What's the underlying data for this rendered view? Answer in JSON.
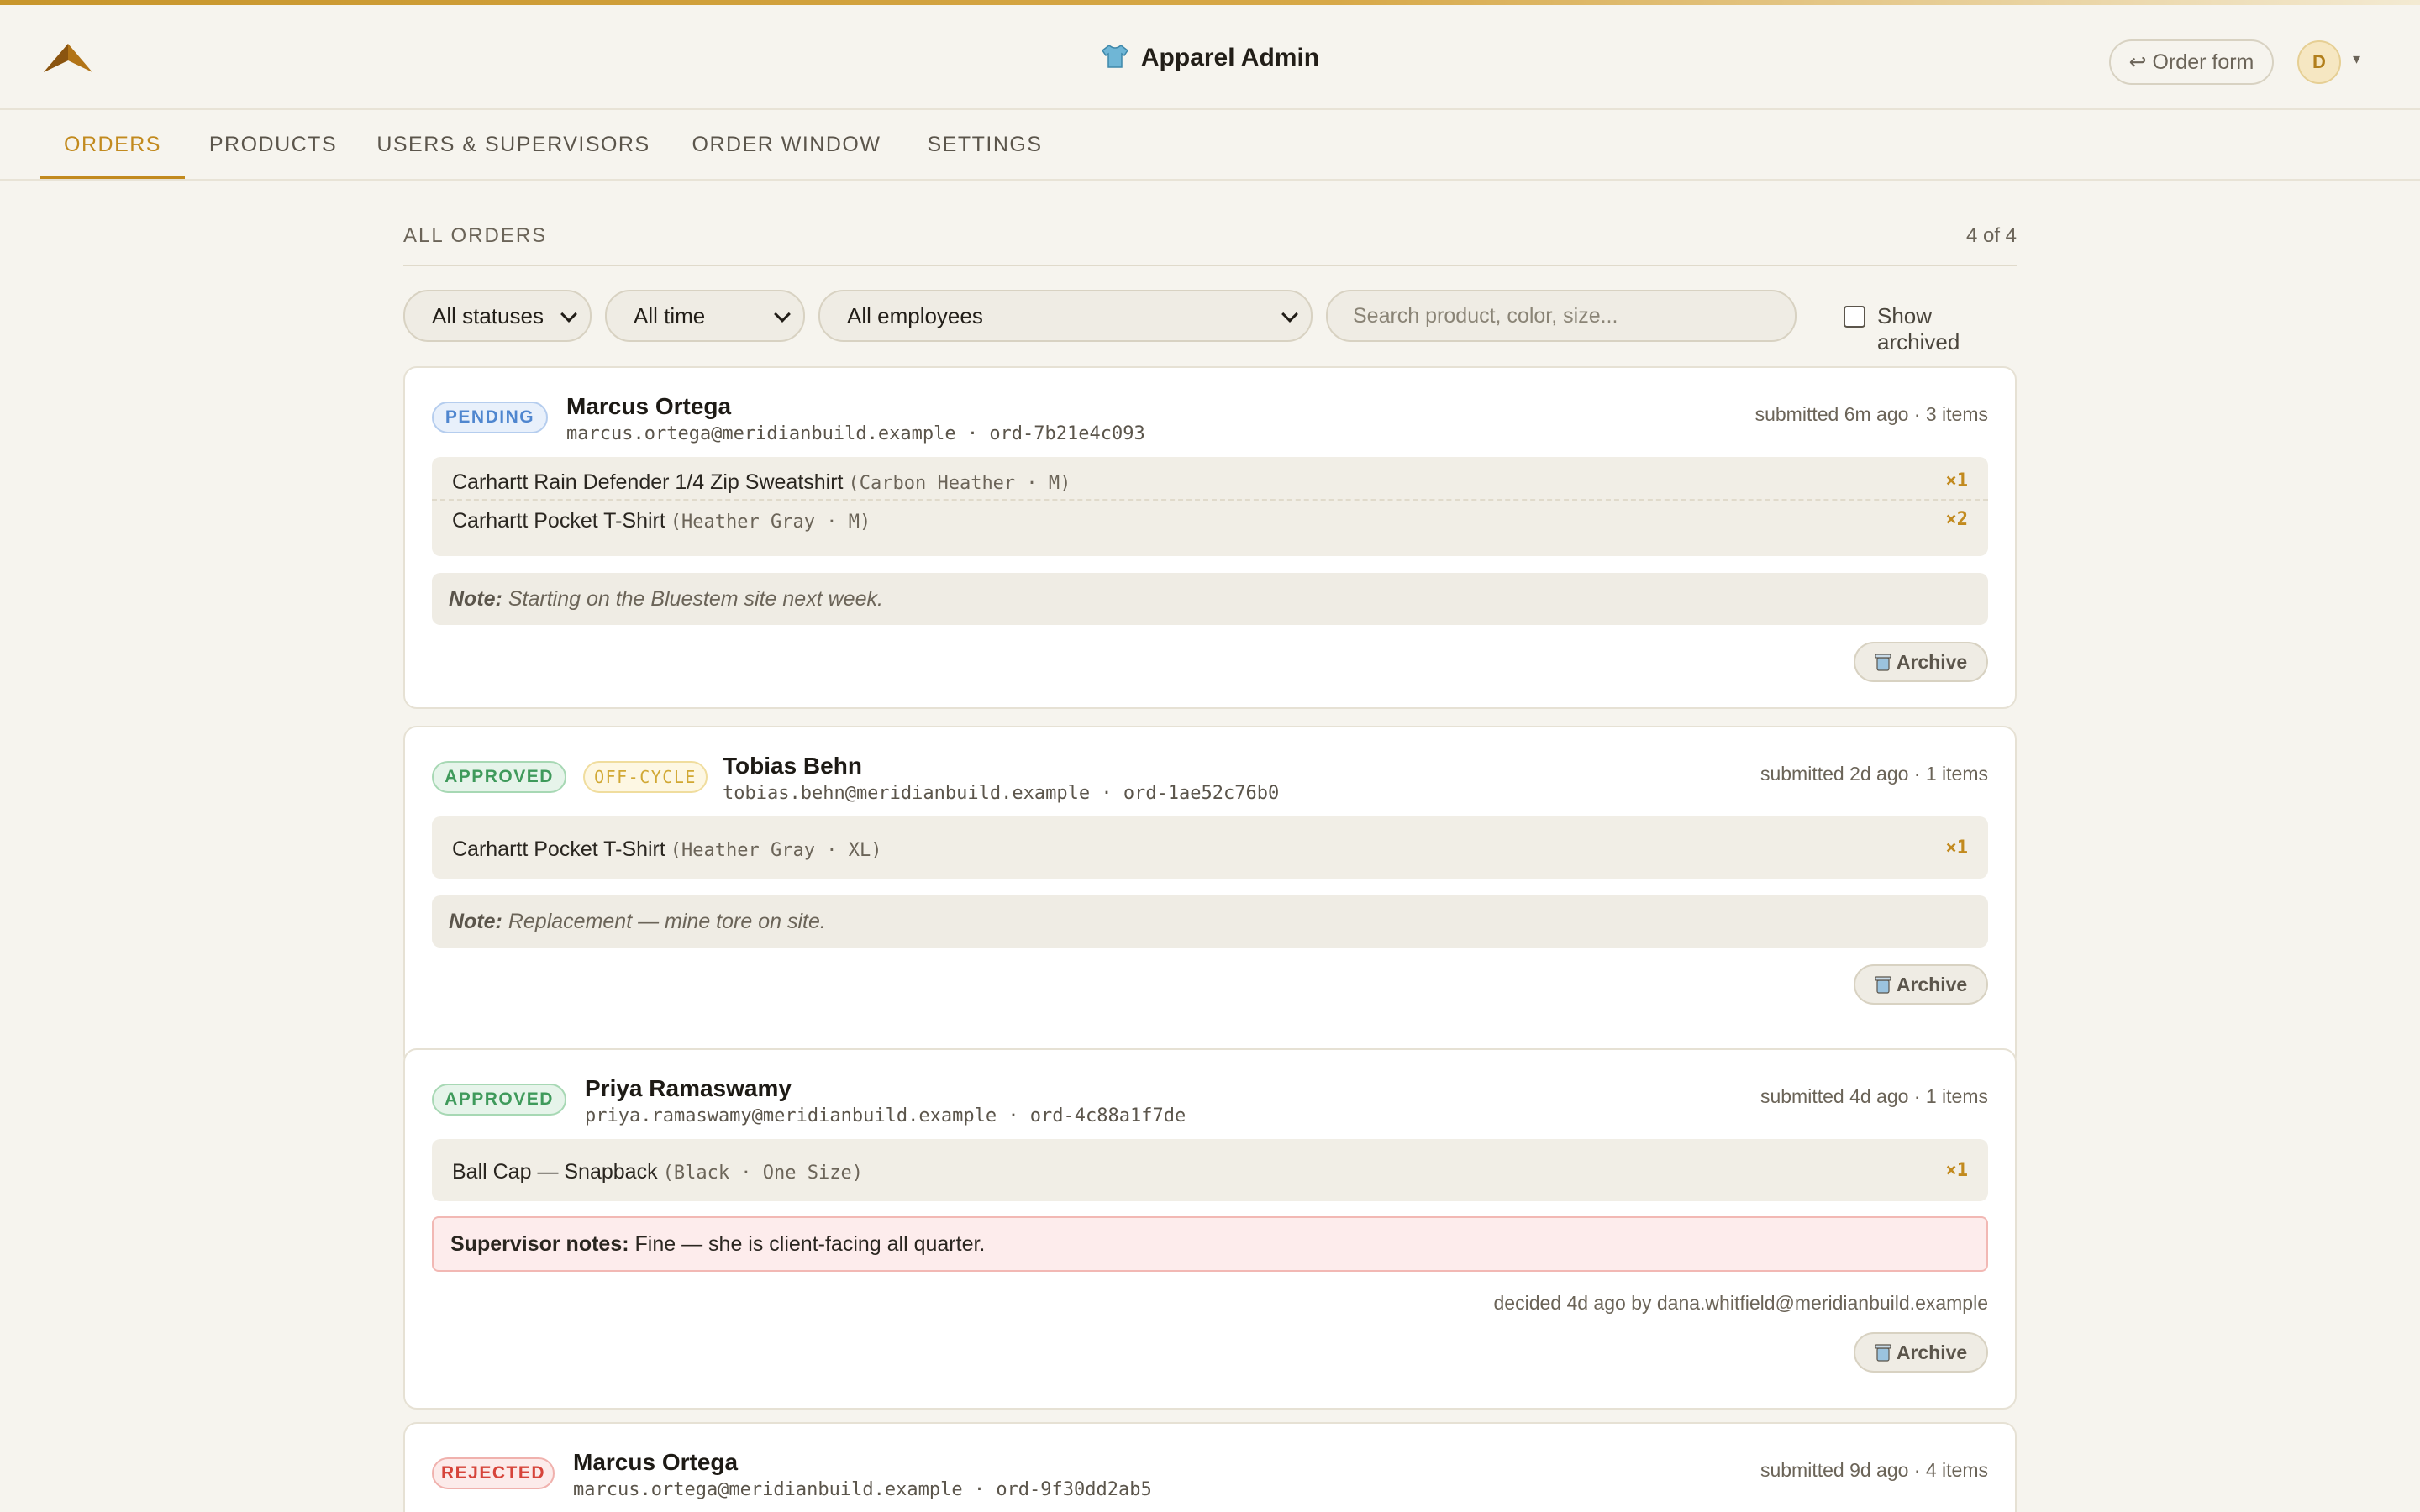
{
  "app": {
    "title": "Apparel Admin",
    "order_form_label": "↩ Order form",
    "avatar_initial": "D",
    "avatar_caret": "▾"
  },
  "tabs": [
    {
      "label": "ORDERS",
      "active": true
    },
    {
      "label": "PRODUCTS"
    },
    {
      "label": "USERS & SUPERVISORS"
    },
    {
      "label": "ORDER WINDOW"
    },
    {
      "label": "SETTINGS"
    }
  ],
  "section": {
    "title": "ALL ORDERS",
    "count": "4 of 4"
  },
  "filters": {
    "status": "All statuses",
    "time": "All time",
    "employee": "All employees",
    "search_placeholder": "Search product, color, size...",
    "show_archived_label": "Show archived",
    "show_archived": false
  },
  "orders": [
    {
      "status": "PENDING",
      "name": "Marcus Ortega",
      "sub": "marcus.ortega@meridianbuild.example · ord-7b21e4c093",
      "meta": "submitted 6m ago · 3 items",
      "items": [
        {
          "product": "Carhartt Rain Defender 1/4 Zip Sweatshirt",
          "variant": "(Carbon Heather · M)",
          "qty": "×1"
        },
        {
          "product": "Carhartt Pocket T-Shirt",
          "variant": "(Heather Gray · M)",
          "qty": "×2"
        }
      ],
      "note_label": "Note:",
      "note": "Starting on the Bluestem site next week.",
      "archive_label": "Archive"
    },
    {
      "status": "APPROVED",
      "tag": "OFF-CYCLE",
      "name": "Tobias Behn",
      "sub": "tobias.behn@meridianbuild.example · ord-1ae52c76b0",
      "meta": "submitted 2d ago · 1 items",
      "items": [
        {
          "product": "Carhartt Pocket T-Shirt",
          "variant": "(Heather Gray · XL)",
          "qty": "×1"
        }
      ],
      "note_label": "Note:",
      "note": "Replacement — mine tore on site.",
      "archive_label": "Archive"
    },
    {
      "status": "APPROVED",
      "name": "Priya Ramaswamy",
      "sub": "priya.ramaswamy@meridianbuild.example · ord-4c88a1f7de",
      "meta": "submitted 4d ago · 1 items",
      "items": [
        {
          "product": "Ball Cap — Snapback",
          "variant": "(Black · One Size)",
          "qty": "×1"
        }
      ],
      "supervisor_label": "Supervisor notes:",
      "supervisor_note": "Fine — she is client-facing all quarter.",
      "decided": "decided 4d ago by dana.whitfield@meridianbuild.example",
      "archive_label": "Archive"
    },
    {
      "status": "REJECTED",
      "name": "Marcus Ortega",
      "sub": "marcus.ortega@meridianbuild.example · ord-9f30dd2ab5",
      "meta": "submitted 9d ago · 4 items"
    }
  ],
  "colors": {
    "accent": "#c28a1e",
    "pending": "#4f86cf",
    "approved": "#3f9a5b",
    "rejected": "#d6443a",
    "offcycle": "#d1a834"
  }
}
